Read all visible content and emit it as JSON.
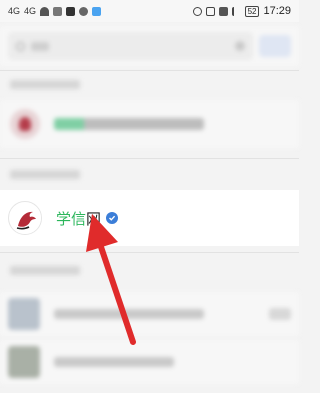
{
  "status_bar": {
    "left_indicators": [
      "4G",
      "4G"
    ],
    "icons": [
      "wifi-icon",
      "gallery-icon",
      "tiktok-icon",
      "app-icon",
      "message-icon"
    ],
    "right_icons": [
      "eye-icon",
      "nfc-icon",
      "mute-icon",
      "bluetooth-icon"
    ],
    "battery": "52",
    "time": "17:29"
  },
  "result": {
    "name_green": "学信",
    "name_dark": "网",
    "verified_icon": "verified-badge-icon"
  },
  "colors": {
    "name_green": "#2bb65b",
    "verified": "#3b7ed8",
    "arrow": "#e02b2b"
  }
}
